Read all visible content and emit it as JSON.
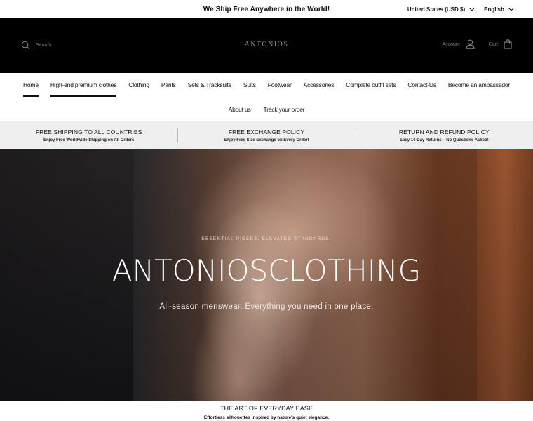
{
  "announcement": {
    "message": "We Ship Free Anywhere in the World!",
    "currency": "United States (USD $)",
    "language": "English"
  },
  "header": {
    "search_label": "Search",
    "logo": "ANTONIOS",
    "account_label": "Account",
    "cart_label": "Cart"
  },
  "nav": {
    "row1": [
      "Home",
      "High-end premium clothes",
      "Clothing",
      "Pants",
      "Sets & Tracksuits",
      "Suits",
      "Footwear",
      "Accessories",
      "Complete outfit sets",
      "Contact-Us",
      "Become an ambassador"
    ],
    "row2": [
      "About us",
      "Track your order"
    ]
  },
  "policy": [
    {
      "title": "FREE SHIPPING TO ALL COUNTRIES",
      "subtitle": "Enjoy Free Worldwide Shipping on All Orders"
    },
    {
      "title": "FREE EXCHANGE POLICY",
      "subtitle": "Enjoy Free Size Exchange on Every Order!"
    },
    {
      "title": "RETURN AND REFUND POLICY",
      "subtitle": "Easy 14-Day Returns – No Questions Asked!"
    }
  ],
  "hero": {
    "kicker": "ESSENTIAL PIECES. ELEVATED STANDARDS.",
    "title": "ANTONIOSCLOTHING",
    "subtitle": "All-season menswear. Everything you need in one place."
  },
  "bottom": {
    "title": "THE ART OF EVERYDAY EASE",
    "subtitle": "Effortless silhouettes inspired by nature's quiet elegance."
  },
  "icons": {
    "search": "search-icon",
    "account": "user-icon",
    "cart": "shopping-bag-icon",
    "dropdown": "chevron-down-icon"
  }
}
